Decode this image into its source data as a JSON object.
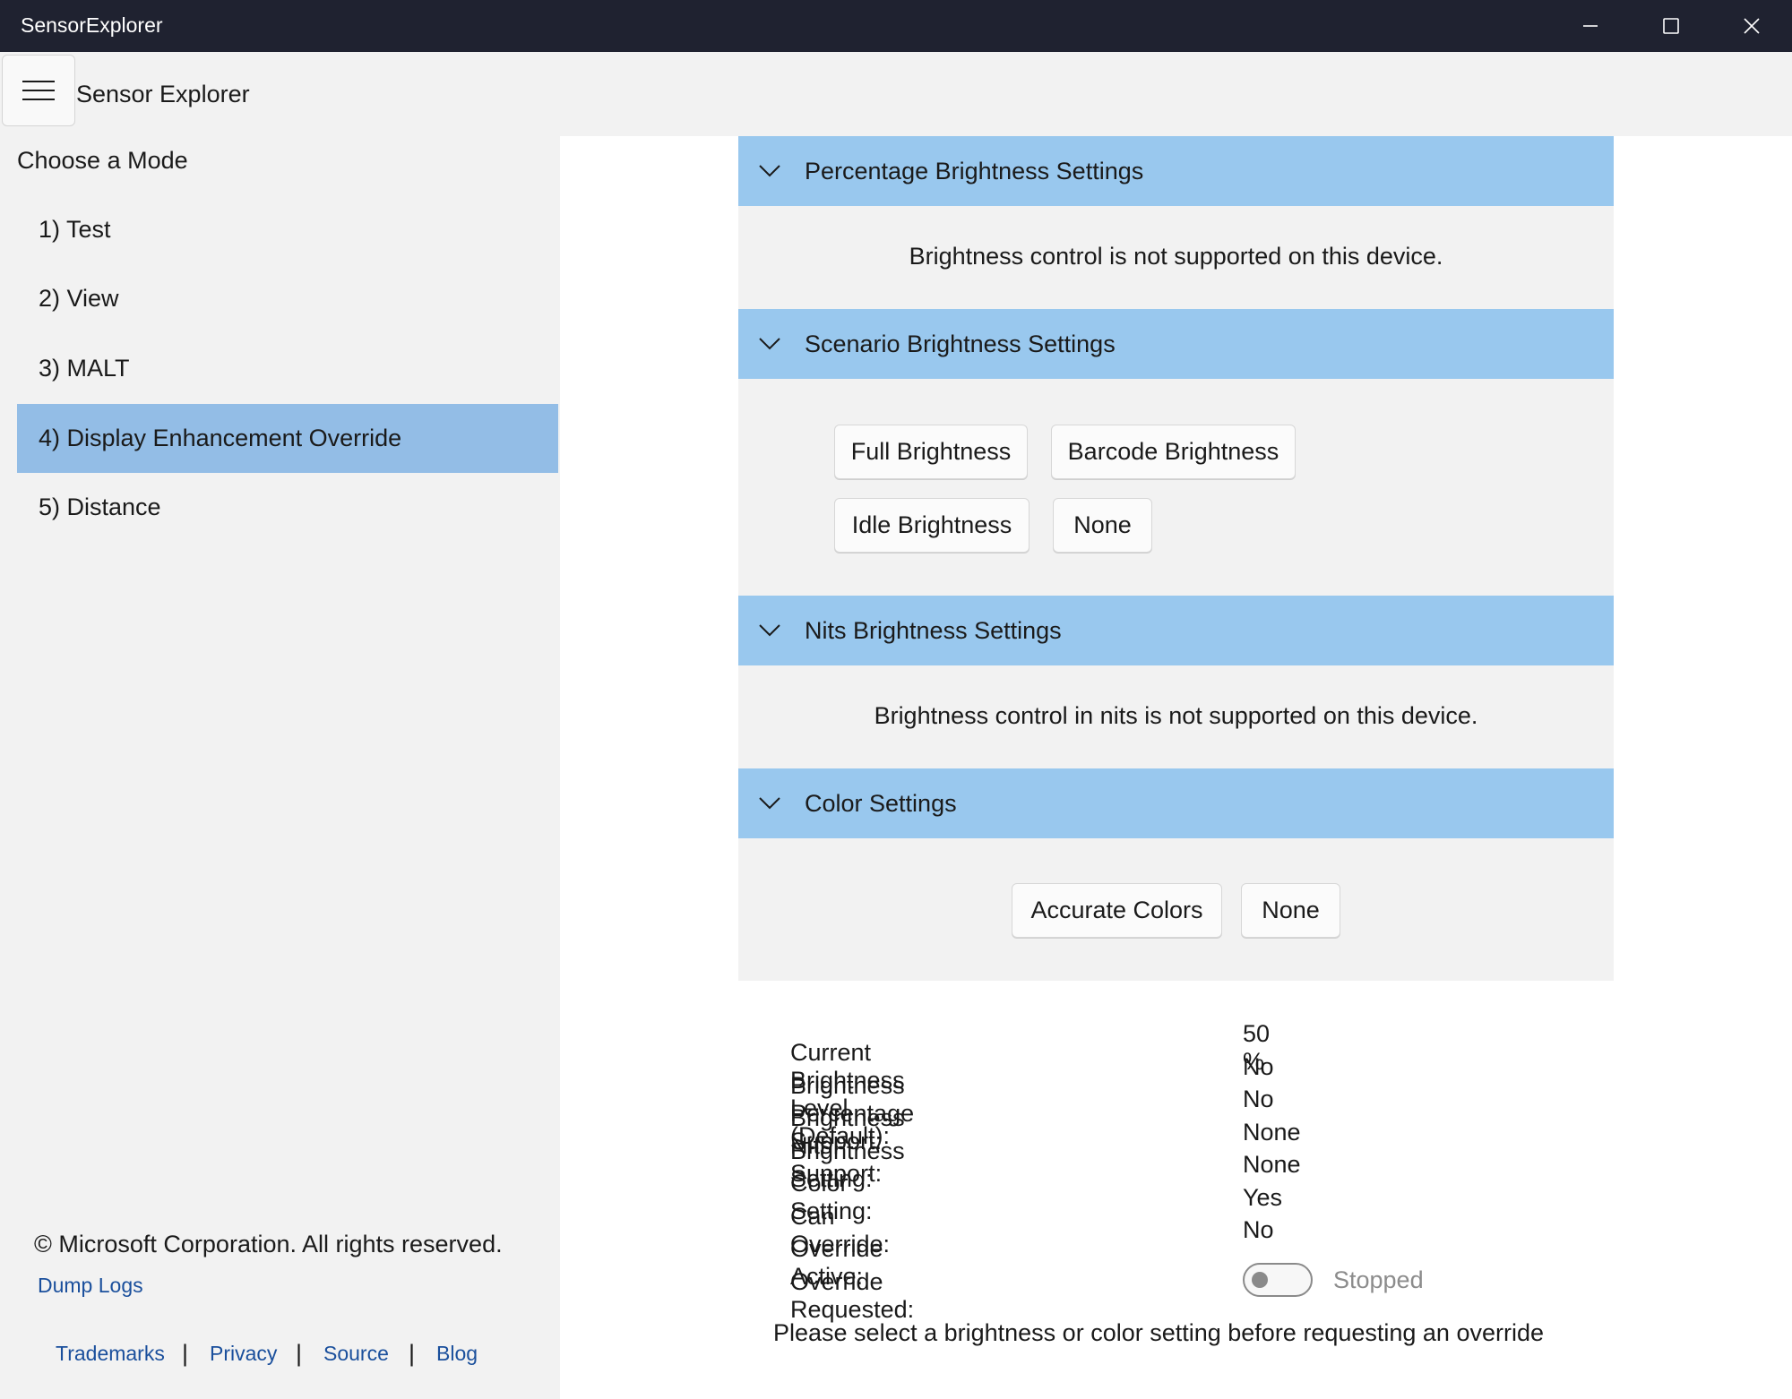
{
  "window": {
    "title": "SensorExplorer",
    "controls": [
      "minimize",
      "maximize",
      "close"
    ]
  },
  "sidebar": {
    "app_title": "Sensor Explorer",
    "menu_icon": "hamburger-icon",
    "heading": "Choose a Mode",
    "items": [
      {
        "label": "1) Test",
        "selected": false
      },
      {
        "label": "2) View",
        "selected": false
      },
      {
        "label": "3) MALT",
        "selected": false
      },
      {
        "label": "4) Display Enhancement Override",
        "selected": true
      },
      {
        "label": "5) Distance",
        "selected": false
      }
    ],
    "copyright": "© Microsoft Corporation. All rights reserved.",
    "dump_logs": "Dump Logs",
    "footer_links": [
      "Trademarks",
      "Privacy",
      "Source",
      "Blog"
    ],
    "separator": "|"
  },
  "sections": {
    "percentage": {
      "title": "Percentage Brightness Settings",
      "message": "Brightness control is not supported on this device."
    },
    "scenario": {
      "title": "Scenario Brightness Settings",
      "buttons": [
        "Full Brightness",
        "Barcode Brightness",
        "Idle Brightness",
        "None"
      ]
    },
    "nits": {
      "title": "Nits Brightness Settings",
      "message": "Brightness control in nits is not supported on this device."
    },
    "color": {
      "title": "Color Settings",
      "buttons": [
        "Accurate Colors",
        "None"
      ]
    }
  },
  "status": {
    "rows": [
      {
        "label": "Current Brightness Level (Default):",
        "value": "50 %"
      },
      {
        "label": "Brightness Percentage Support:",
        "value": "No"
      },
      {
        "label": "Brightness Nits Support:",
        "value": "No"
      },
      {
        "label": "Brightness Setting:",
        "value": "None"
      },
      {
        "label": "Color Setting:",
        "value": "None"
      },
      {
        "label": "Can Override:",
        "value": "Yes"
      },
      {
        "label": "Override Active:",
        "value": "No"
      },
      {
        "label": "Override Requested:",
        "value": ""
      }
    ],
    "override_toggle": {
      "on": false,
      "label": "Stopped"
    },
    "hint": "Please select a brightness or color setting before requesting an override"
  },
  "colors": {
    "titlebar": "#1f2230",
    "sidebar_bg": "#f2f2f2",
    "selected_item": "#93bde6",
    "section_header": "#99c8ee",
    "link": "#1a4f9c"
  }
}
